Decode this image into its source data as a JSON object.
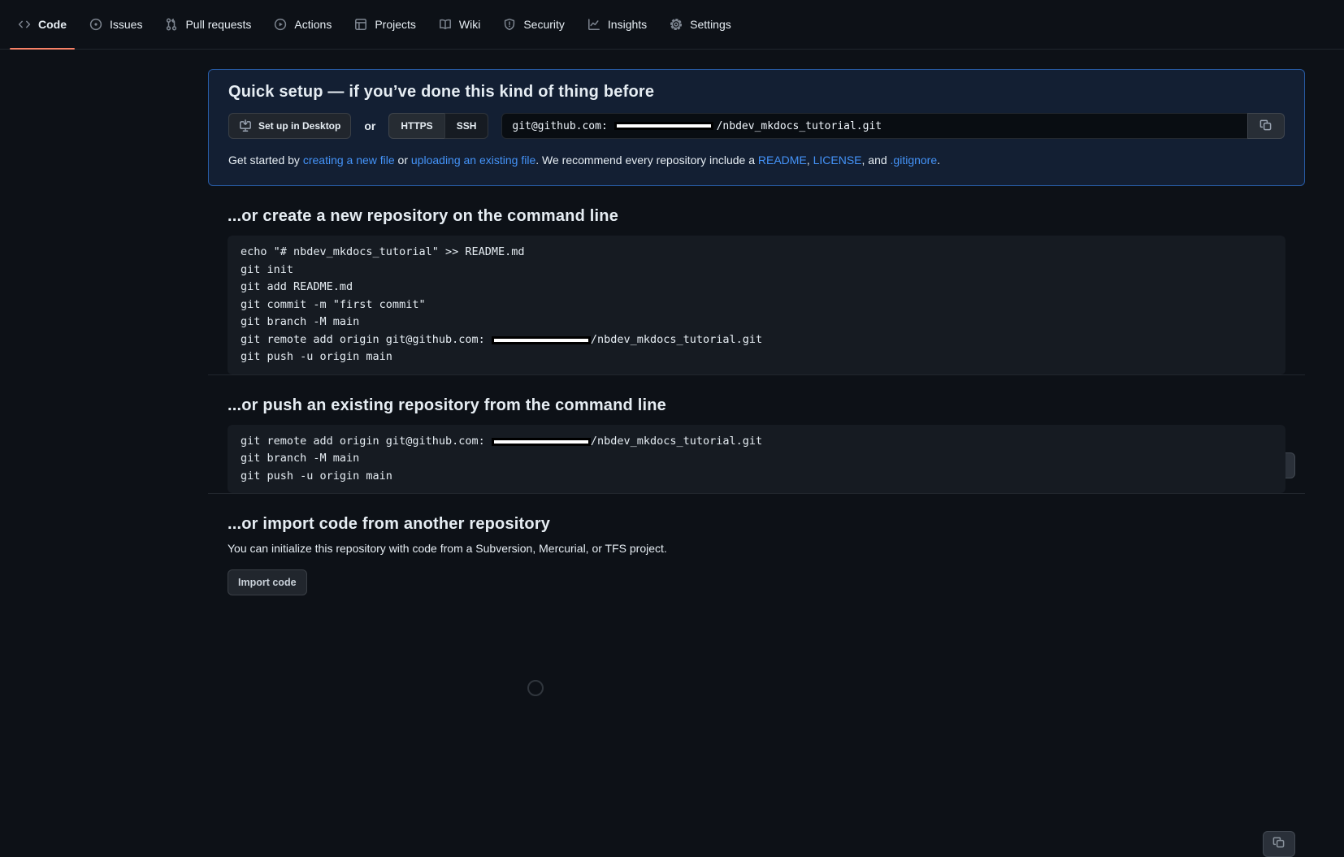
{
  "nav": {
    "tabs": [
      {
        "label": "Code",
        "icon": "code-icon",
        "active": true
      },
      {
        "label": "Issues",
        "icon": "issue-opened-icon",
        "active": false
      },
      {
        "label": "Pull requests",
        "icon": "pull-request-icon",
        "active": false
      },
      {
        "label": "Actions",
        "icon": "play-icon",
        "active": false
      },
      {
        "label": "Projects",
        "icon": "table-icon",
        "active": false
      },
      {
        "label": "Wiki",
        "icon": "book-icon",
        "active": false
      },
      {
        "label": "Security",
        "icon": "shield-icon",
        "active": false
      },
      {
        "label": "Insights",
        "icon": "graph-icon",
        "active": false
      },
      {
        "label": "Settings",
        "icon": "gear-icon",
        "active": false
      }
    ]
  },
  "quick_setup": {
    "title": "Quick setup — if you’ve done this kind of thing before",
    "desktop_button_label": "Set up in Desktop",
    "or_label": "or",
    "protocol": {
      "https_label": "HTTPS",
      "ssh_label": "SSH",
      "selected": "SSH"
    },
    "repo_url": {
      "prefix": "git@github.com: ",
      "redacted": true,
      "suffix": "/nbdev_mkdocs_tutorial.git"
    },
    "get_started_segments": [
      {
        "text": "Get started by "
      },
      {
        "text": "creating a new file",
        "link": true
      },
      {
        "text": " or "
      },
      {
        "text": "uploading an existing file",
        "link": true
      },
      {
        "text": ". We recommend every repository include a "
      },
      {
        "text": "README",
        "link": true
      },
      {
        "text": ", "
      },
      {
        "text": "LICENSE",
        "link": true
      },
      {
        "text": ", and "
      },
      {
        "text": ".gitignore",
        "link": true
      },
      {
        "text": "."
      }
    ]
  },
  "sections": [
    {
      "heading": "...or create a new repository on the command line",
      "code": [
        "echo \"# nbdev_mkdocs_tutorial\" >> README.md",
        "git init",
        "git add README.md",
        "git commit -m \"first commit\"",
        "git branch -M main",
        "git remote add origin git@github.com: {{REDACTED}}/nbdev_mkdocs_tutorial.git",
        "git push -u origin main"
      ]
    },
    {
      "heading": "...or push an existing repository from the command line",
      "code": [
        "git remote add origin git@github.com: {{REDACTED}}/nbdev_mkdocs_tutorial.git",
        "git branch -M main",
        "git push -u origin main"
      ]
    },
    {
      "heading": "...or import code from another repository",
      "description": "You can initialize this repository with code from a Subversion, Mercurial, or TFS project.",
      "button_label": "Import code"
    }
  ],
  "colors": {
    "page_bg": "#0d1117",
    "active_tab_underline": "#f78166",
    "link": "#4493f8",
    "info_box_bg": "#131f33",
    "info_box_border": "#388bfd",
    "code_block_bg": "#161b22",
    "divider": "#21262d"
  }
}
